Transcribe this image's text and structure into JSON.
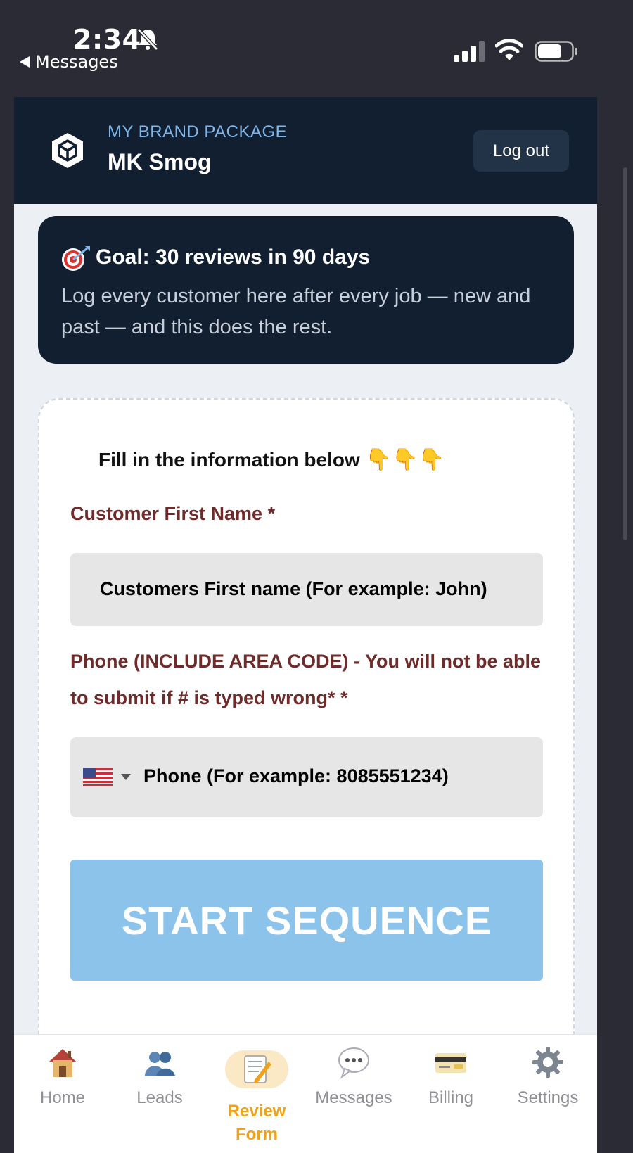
{
  "status_bar": {
    "time": "2:34",
    "back_label": "Messages",
    "icons": [
      "bell-slash-icon",
      "signal-icon",
      "wifi-icon",
      "battery-icon"
    ]
  },
  "header": {
    "eyebrow": "MY BRAND PACKAGE",
    "brand_name": "MK Smog",
    "logout_label": "Log out",
    "logo_icon": "cube-icon"
  },
  "goal": {
    "icon": "target-icon",
    "title": "Goal: 30 reviews in 90 days",
    "description": "Log every customer here after every job — new and past — and this does the rest."
  },
  "form": {
    "intro": "Fill in the information below",
    "first_name_label": "Customer First Name *",
    "first_name_placeholder": "Customers First name (For example: John)",
    "phone_label": "Phone (INCLUDE AREA CODE) - You will not be able to submit if # is typed wrong* *",
    "phone_placeholder": "Phone (For example: 8085551234)",
    "submit_label": "START SEQUENCE"
  },
  "nav": {
    "items": [
      {
        "label": "Home",
        "icon": "house-icon",
        "active": false
      },
      {
        "label": "Leads",
        "icon": "people-icon",
        "active": false
      },
      {
        "label": "Review Form",
        "icon": "memo-icon",
        "active": true
      },
      {
        "label": "Messages",
        "icon": "chat-bubble-icon",
        "active": false
      },
      {
        "label": "Billing",
        "icon": "credit-card-icon",
        "active": false
      },
      {
        "label": "Settings",
        "icon": "gear-icon",
        "active": false
      }
    ]
  },
  "colors": {
    "header_bg": "#111f31",
    "label": "#6f2a2a",
    "submit_bg": "#8cc3ea",
    "active_nav": "#f0a21a"
  }
}
